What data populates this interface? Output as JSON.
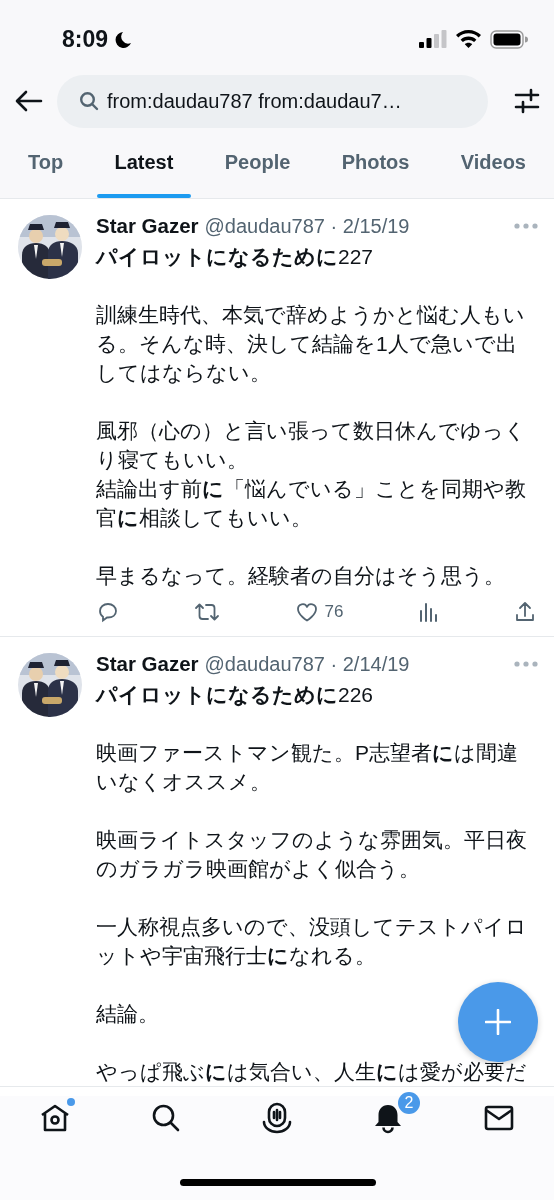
{
  "status_bar": {
    "time": "8:09"
  },
  "search": {
    "value": "from:daudau787 from:daudau7…"
  },
  "tabs": [
    {
      "label": "Top",
      "selected": false
    },
    {
      "label": "Latest",
      "selected": true
    },
    {
      "label": "People",
      "selected": false
    },
    {
      "label": "Photos",
      "selected": false
    },
    {
      "label": "Videos",
      "selected": false
    }
  ],
  "tweets": [
    {
      "name": "Star Gazer",
      "meta": "@daudau787 · 2/15/19",
      "paragraphs": [
        [
          "**パイロットになるために**227"
        ],
        [
          "訓練生時代、本気で辞めようかと悩む人もいる。そんな時、決して結論を1人で急いで出してはならない。"
        ],
        [
          "風邪（心の）と言い張って数日休んでゆっくり寝てもいい。",
          "結論出す前**に**「悩んでいる」ことを同期や教官**に**相談してもいい。"
        ],
        [
          "早まるなって。経験者の自分はそう思う。"
        ]
      ],
      "actions": [
        {
          "kind": "reply"
        },
        {
          "kind": "retweet"
        },
        {
          "kind": "like",
          "count": "76"
        },
        {
          "kind": "views"
        },
        {
          "kind": "share"
        }
      ]
    },
    {
      "name": "Star Gazer",
      "meta": "@daudau787 · 2/14/19",
      "paragraphs": [
        [
          "**パイロットになるために**226"
        ],
        [
          "映画ファーストマン観た。P志望者**に**は間違いなくオススメ。"
        ],
        [
          "映画ライトスタッフのような雰囲気。平日夜のガラガラ映画館がよく似合う。"
        ],
        [
          "一人称視点多いので、没頭してテストパイロットや宇宙飛行士**に**なれる。"
        ],
        [
          "結論。"
        ],
        [
          "やっぱ飛ぶ**に**は気合い、人生**に**は愛が必要だ"
        ]
      ]
    }
  ],
  "bottom_nav": [
    {
      "kind": "home",
      "new": true
    },
    {
      "kind": "search",
      "new": false
    },
    {
      "kind": "spaces",
      "new": false
    },
    {
      "kind": "notifications",
      "new": false,
      "badge": "2"
    },
    {
      "kind": "messages",
      "new": false
    }
  ]
}
